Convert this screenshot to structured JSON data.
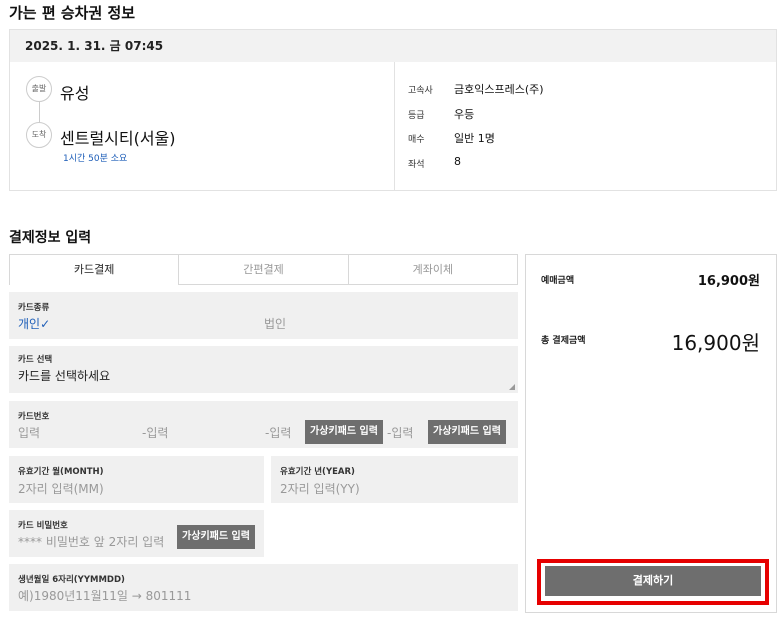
{
  "ticket": {
    "heading": "가는 편 승차권 정보",
    "datetime": "2025. 1. 31. 금 07:45",
    "depart_badge": "출발",
    "depart_place": "유성",
    "arrive_badge": "도착",
    "arrive_place": "센트럴시티(서울)",
    "duration": "1시간 50분 소요",
    "info": [
      {
        "key": "고속사",
        "value": "금호익스프레스(주)"
      },
      {
        "key": "등급",
        "value": "우등"
      },
      {
        "key": "매수",
        "value": "일반 1명"
      },
      {
        "key": "좌석",
        "value": "8"
      }
    ]
  },
  "payment": {
    "heading": "결제정보 입력",
    "tabs": [
      {
        "label": "카드결제",
        "active": true
      },
      {
        "label": "간편결제",
        "active": false
      },
      {
        "label": "계좌이체",
        "active": false
      }
    ],
    "card_type": {
      "label": "카드종류",
      "options": [
        "개인",
        "법인"
      ],
      "selected": "개인",
      "check": "✓"
    },
    "card_select": {
      "label": "카드 선택",
      "value": "카드를 선택하세요"
    },
    "card_number": {
      "label": "카드번호",
      "placeholder": "입력",
      "separator": "-",
      "virtual_keypad": "가상키패드 입력"
    },
    "expiry_month": {
      "label": "유효기간 월(MONTH)",
      "placeholder": "2자리 입력(MM)"
    },
    "expiry_year": {
      "label": "유효기간 년(YEAR)",
      "placeholder": "2자리 입력(YY)"
    },
    "card_password": {
      "label": "카드 비밀번호",
      "placeholder": "**** 비밀번호 앞 2자리 입력",
      "virtual_keypad": "가상키패드 입력"
    },
    "birth": {
      "label": "생년월일 6자리(YYMMDD)",
      "placeholder": "예)1980년11월11일 → 801111"
    }
  },
  "summary": {
    "booking_label": "예매금액",
    "booking_amount": "16,900원",
    "total_label": "총 결제금액",
    "total_amount": "16,900원",
    "pay_button": "결제하기"
  },
  "colors": {
    "accent_blue": "#1e5eb8",
    "button_gray": "#6e6e6e",
    "highlight_red": "#e60000"
  }
}
